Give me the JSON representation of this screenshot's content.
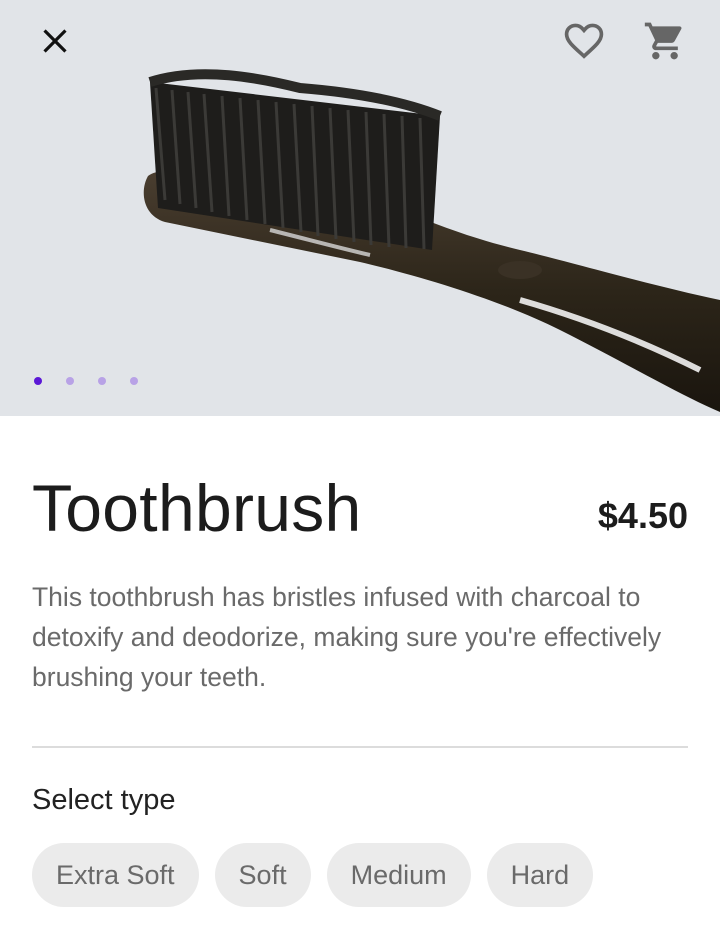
{
  "header": {
    "close_icon": "close-icon",
    "favorite_icon": "heart-outline-icon",
    "cart_icon": "shopping-cart-icon"
  },
  "carousel": {
    "image": "charcoal-toothbrush-photo",
    "image_count": 4,
    "active_index": 0,
    "colors": {
      "active_dot": "#5b18d6",
      "inactive_dot": "#b8a2e6",
      "background": "#e1e4e8"
    }
  },
  "product": {
    "title": "Toothbrush",
    "price": "$4.50",
    "description": "This toothbrush has bristles infused with charcoal to detoxify and deodorize, making sure you're effectively brushing your teeth."
  },
  "type_selector": {
    "label": "Select type",
    "options": [
      {
        "label": "Extra Soft"
      },
      {
        "label": "Soft"
      },
      {
        "label": "Medium"
      },
      {
        "label": "Hard"
      }
    ]
  }
}
